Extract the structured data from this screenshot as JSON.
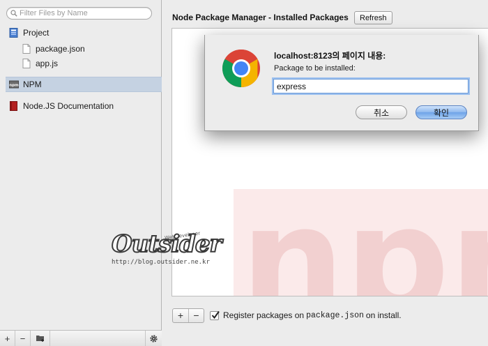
{
  "sidebar": {
    "search_placeholder": "Filter Files by Name",
    "items": [
      {
        "label": "Project",
        "icon": "project-icon"
      },
      {
        "label": "package.json",
        "icon": "file-icon"
      },
      {
        "label": "app.js",
        "icon": "file-icon"
      },
      {
        "label": "NPM",
        "icon": "npm-icon",
        "selected": true
      },
      {
        "label": "Node.JS Documentation",
        "icon": "book-icon"
      }
    ],
    "bottom_buttons": [
      "+",
      "−"
    ]
  },
  "main": {
    "title": "Node Package Manager - Installed Packages",
    "refresh_label": "Refresh",
    "watermark_text": "npm",
    "add_label": "+",
    "remove_label": "−",
    "register": {
      "checked": true,
      "before": "Register packages on",
      "code": "package.json",
      "after": "on install."
    }
  },
  "dialog": {
    "title": "localhost:8123의 페이지 내용:",
    "message": "Package to be installed:",
    "input_value": "express",
    "cancel_label": "취소",
    "ok_label": "확인"
  },
  "watermark": {
    "small": "WebDeveloper",
    "main": "Outsider",
    "url": "http://blog.outsider.ne.kr"
  },
  "colors": {
    "selection": "#c5d2e2",
    "ok_button": "#8db8ee",
    "npm_watermark": "#f6d3d3"
  }
}
